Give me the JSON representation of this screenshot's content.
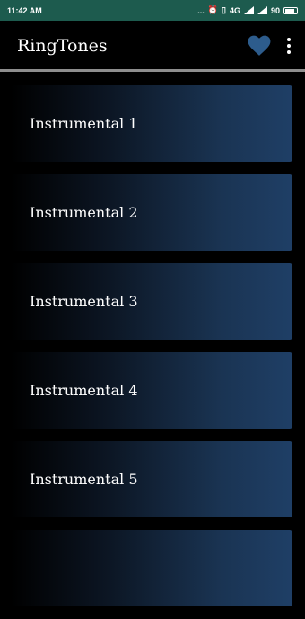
{
  "status_bar": {
    "time": "11:42 AM",
    "indicators": "...",
    "network": "4G",
    "battery": "90"
  },
  "app_bar": {
    "title": "RingTones",
    "favorite_icon": "heart-icon",
    "menu_icon": "more-vert-icon",
    "accent_color": "#2d5c8c"
  },
  "list": {
    "items": [
      {
        "label": "Instrumental 1"
      },
      {
        "label": "Instrumental 2"
      },
      {
        "label": "Instrumental 3"
      },
      {
        "label": "Instrumental 4"
      },
      {
        "label": "Instrumental 5"
      },
      {
        "label": ""
      }
    ]
  }
}
